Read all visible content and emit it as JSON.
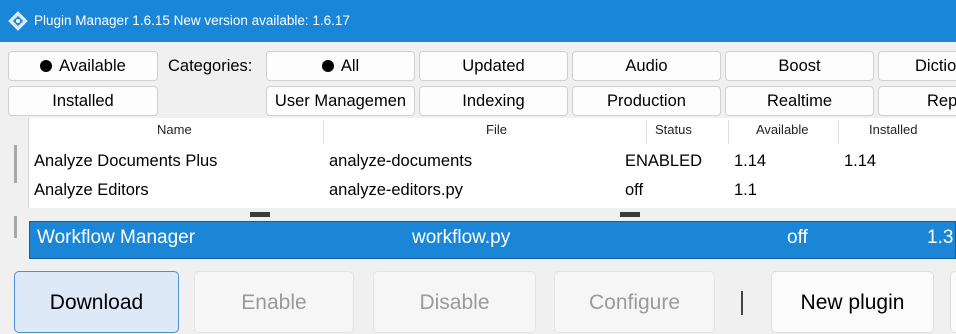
{
  "window": {
    "title": "Plugin Manager 1.6.15 New version available: 1.6.17"
  },
  "filters": {
    "available_label": "Available",
    "categories_label": "Categories:",
    "installed_label": "Installed",
    "row1": [
      "All",
      "Updated",
      "Audio",
      "Boost",
      "Dictio"
    ],
    "row2": [
      "User Managemen",
      "Indexing",
      "Production",
      "Realtime",
      "Rep"
    ]
  },
  "table": {
    "columns": [
      "Name",
      "File",
      "Status",
      "Available",
      "Installed"
    ],
    "rows": [
      [
        "Analyze Documents Plus",
        "analyze-documents",
        "ENABLED",
        "1.14",
        "1.14"
      ],
      [
        "Analyze Editors",
        "analyze-editors.py",
        "off",
        "1.1",
        ""
      ]
    ],
    "selected": [
      "Workflow Manager",
      "workflow.py",
      "off",
      "1.3"
    ]
  },
  "actions": {
    "download": "Download",
    "enable": "Enable",
    "disable": "Disable",
    "configure": "Configure",
    "new_plugin": "New plugin"
  },
  "colors": {
    "titlebar": "#1a86d8",
    "selection": "#1c86d6",
    "window_bg": "#f0f0f0"
  }
}
